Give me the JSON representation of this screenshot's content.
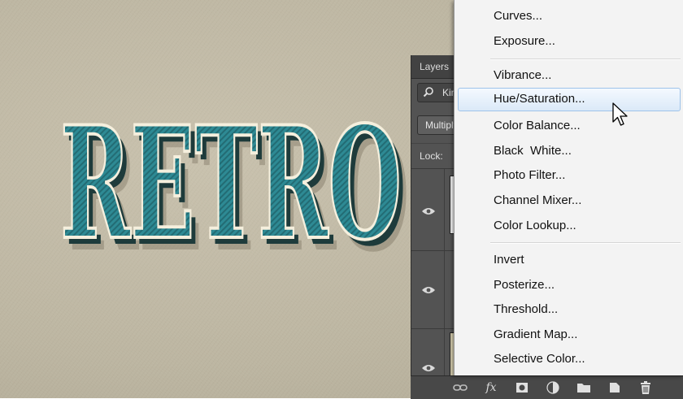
{
  "canvas": {
    "artwork_text": "RETRO",
    "colors": {
      "background": "#bfb8a4",
      "letter_fill": "#2c8690",
      "letter_outline": "#f6f1e2",
      "extrude": "#1f3a3a"
    }
  },
  "layers_panel": {
    "tab_title": "Layers",
    "filter_placeholder": "Kind",
    "blend_mode": "Multiply",
    "lock_label": "Lock:",
    "layers": [
      {
        "visible_icon": "eye-icon"
      },
      {
        "visible_icon": "eye-icon"
      },
      {
        "visible_icon": "eye-icon"
      }
    ]
  },
  "adjustment_menu": {
    "group1": [
      "Curves...",
      "Exposure..."
    ],
    "group2": [
      "Vibrance...",
      "Hue/Saturation...",
      "Color Balance...",
      "Black  White...",
      "Photo Filter...",
      "Channel Mixer...",
      "Color Lookup..."
    ],
    "group3": [
      "Invert",
      "Posterize...",
      "Threshold...",
      "Gradient Map...",
      "Selective Color..."
    ],
    "highlighted": "Hue/Saturation..."
  },
  "bottom_bar_icons": [
    "link-icon",
    "fx-icon",
    "mask-icon",
    "adjustment-icon",
    "folder-icon",
    "new-layer-icon",
    "trash-icon"
  ],
  "bottom_bar_text": {
    "fx": "fx"
  }
}
